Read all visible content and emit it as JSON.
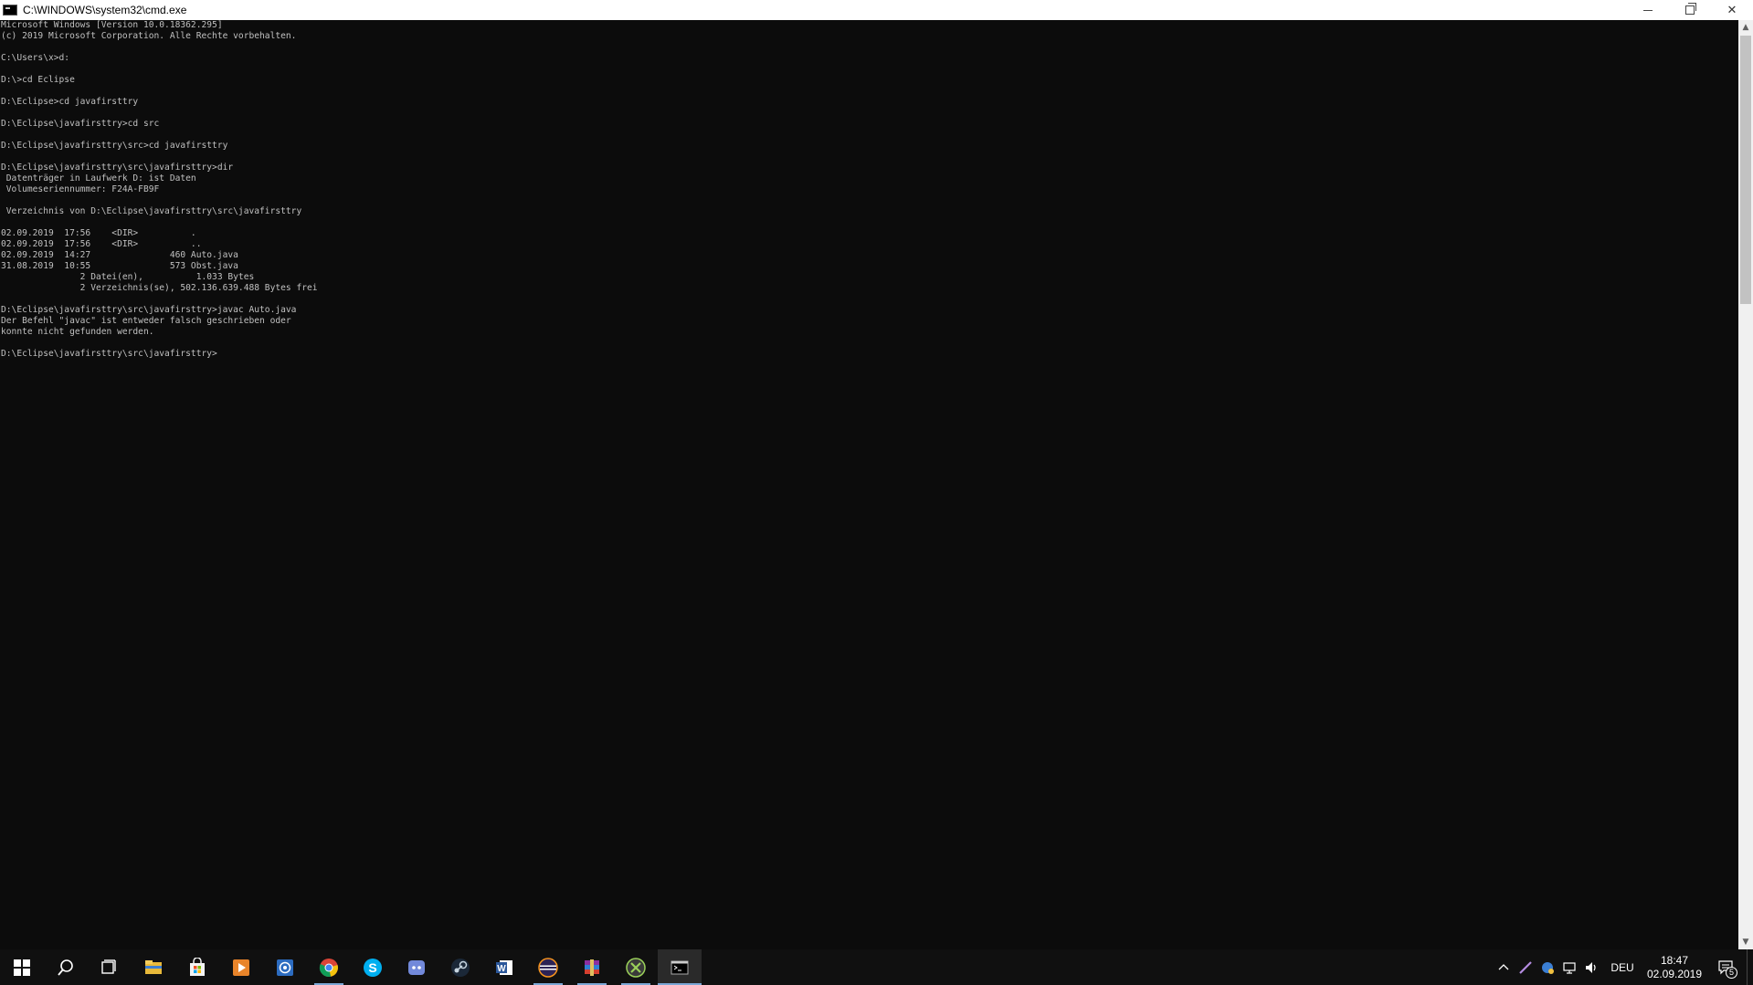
{
  "window": {
    "title": "C:\\WINDOWS\\system32\\cmd.exe"
  },
  "console": {
    "lines": [
      "Microsoft Windows [Version 10.0.18362.295]",
      "(c) 2019 Microsoft Corporation. Alle Rechte vorbehalten.",
      "",
      "C:\\Users\\x>d:",
      "",
      "D:\\>cd Eclipse",
      "",
      "D:\\Eclipse>cd javafirsttry",
      "",
      "D:\\Eclipse\\javafirsttry>cd src",
      "",
      "D:\\Eclipse\\javafirsttry\\src>cd javafirsttry",
      "",
      "D:\\Eclipse\\javafirsttry\\src\\javafirsttry>dir",
      " Datenträger in Laufwerk D: ist Daten",
      " Volumeseriennummer: F24A-FB9F",
      "",
      " Verzeichnis von D:\\Eclipse\\javafirsttry\\src\\javafirsttry",
      "",
      "02.09.2019  17:56    <DIR>          .",
      "02.09.2019  17:56    <DIR>          ..",
      "02.09.2019  14:27               460 Auto.java",
      "31.08.2019  10:55               573 Obst.java",
      "               2 Datei(en),          1.033 Bytes",
      "               2 Verzeichnis(se), 502.136.639.488 Bytes frei",
      "",
      "D:\\Eclipse\\javafirsttry\\src\\javafirsttry>javac Auto.java",
      "Der Befehl \"javac\" ist entweder falsch geschrieben oder",
      "konnte nicht gefunden werden.",
      "",
      "D:\\Eclipse\\javafirsttry\\src\\javafirsttry>"
    ]
  },
  "taskbar": {
    "items": [
      {
        "icon": "search-icon"
      },
      {
        "icon": "task-view-icon"
      },
      {
        "icon": "file-explorer-icon"
      },
      {
        "icon": "microsoft-store-icon"
      },
      {
        "icon": "media-player-icon"
      },
      {
        "icon": "app-icon"
      },
      {
        "icon": "chrome-icon"
      },
      {
        "icon": "skype-icon"
      },
      {
        "icon": "discord-icon"
      },
      {
        "icon": "steam-icon"
      },
      {
        "icon": "word-icon"
      },
      {
        "icon": "eclipse-icon"
      },
      {
        "icon": "winrar-icon"
      },
      {
        "icon": "xbox-icon"
      },
      {
        "icon": "command-prompt-icon"
      }
    ],
    "tray": {
      "language": "DEU",
      "time": "18:47",
      "date": "02.09.2019",
      "notification_count": "5"
    }
  }
}
